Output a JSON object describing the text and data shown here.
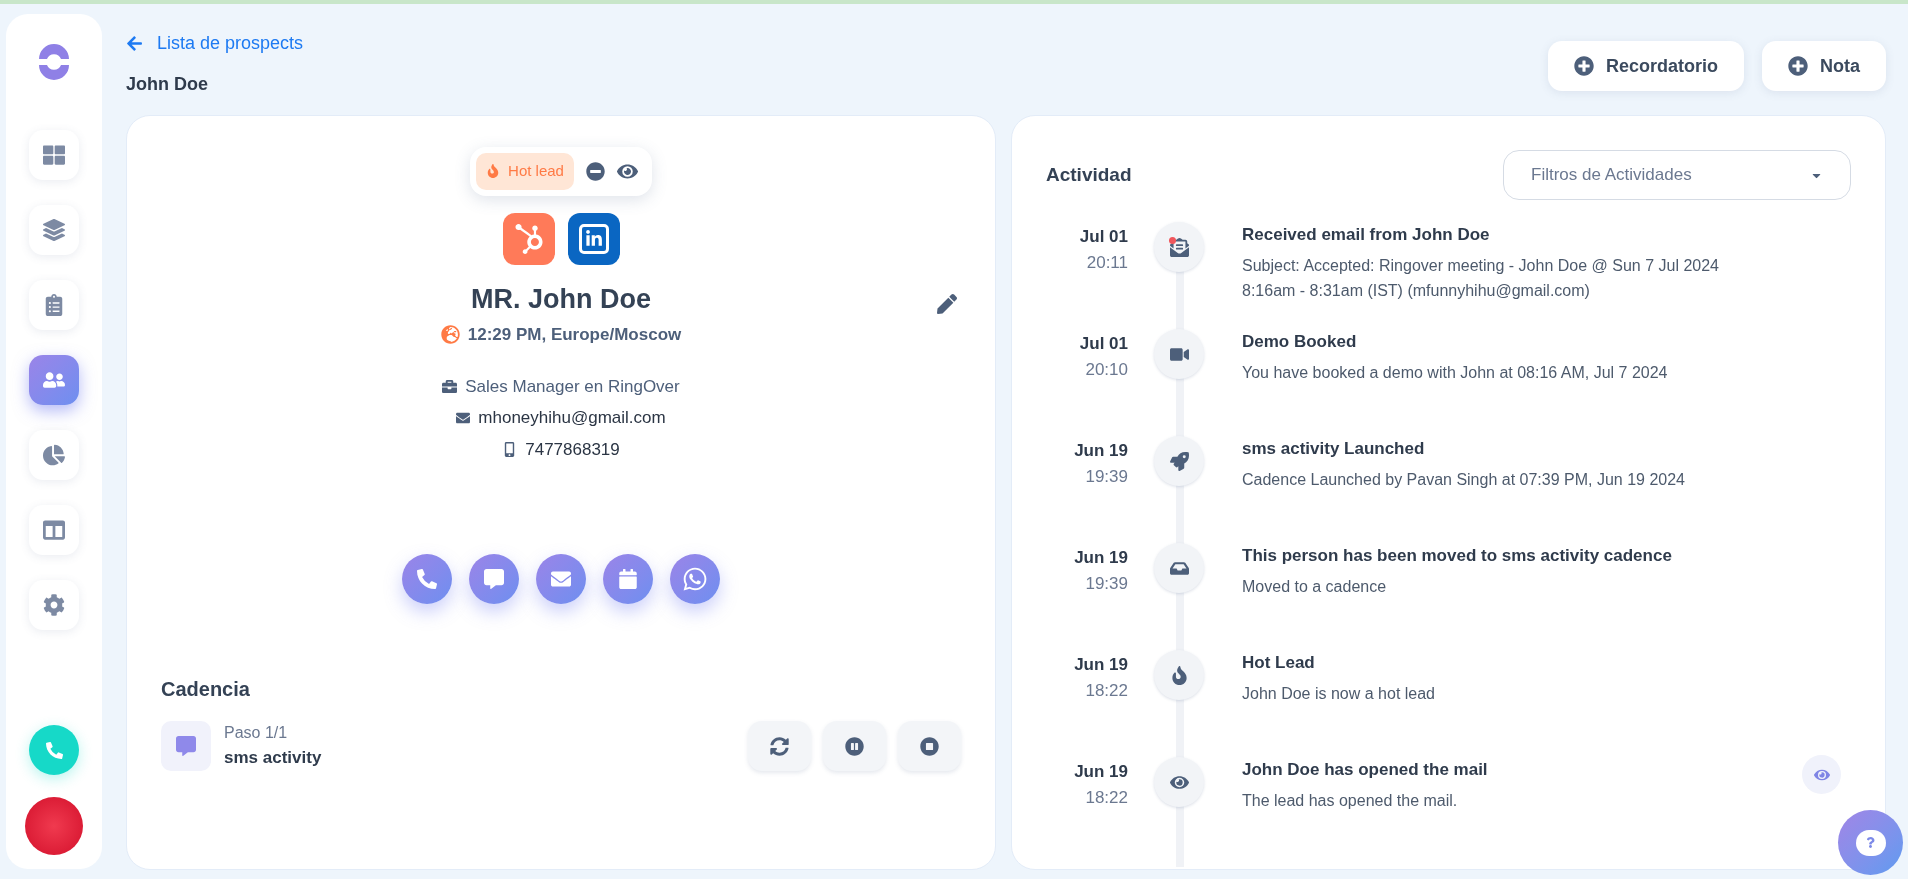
{
  "sidebar": {
    "items": [
      {
        "kind": "dashboard",
        "selected": false
      },
      {
        "kind": "stack",
        "selected": false
      },
      {
        "kind": "clipboard",
        "selected": false
      },
      {
        "kind": "people",
        "selected": true
      },
      {
        "kind": "chart",
        "selected": false
      },
      {
        "kind": "layout",
        "selected": false
      },
      {
        "kind": "settings",
        "selected": false
      }
    ]
  },
  "header": {
    "back_link": "Lista de prospects",
    "title": "John Doe",
    "buttons": [
      "Recordatorio",
      "Nota"
    ]
  },
  "contact": {
    "tag": "Hot lead",
    "name": "MR. John Doe",
    "timezone": "12:29 PM, Europe/Moscow",
    "job": "Sales Manager en RingOver",
    "email": "mhoneyhihu@gmail.com",
    "phone": "7477868319"
  },
  "cadence": {
    "title": "Cadencia",
    "step": "Paso 1/1",
    "activity": "sms activity"
  },
  "activity": {
    "title": "Actividad",
    "filter": {
      "placeholder": "Filtros de Actividades"
    },
    "items": [
      {
        "kind": "email",
        "date": "Jul 01",
        "time": "20:11",
        "title": "Received email from John Doe",
        "text": "Subject: Accepted: Ringover meeting - John Doe @ Sun 7 Jul 2024 8:16am - 8:31am (IST) (mfunnyhihu@gmail.com)",
        "viewable": false
      },
      {
        "kind": "video",
        "date": "Jul 01",
        "time": "20:10",
        "title": "Demo Booked",
        "text": "You have booked a demo with John at 08:16 AM, Jul 7 2024",
        "viewable": false
      },
      {
        "kind": "launch",
        "date": "Jun 19",
        "time": "19:39",
        "title": "sms activity Launched",
        "text": "Cadence Launched by Pavan Singh at 07:39 PM, Jun 19 2024",
        "viewable": false
      },
      {
        "kind": "move",
        "date": "Jun 19",
        "time": "19:39",
        "title": "This person has been moved to sms activity cadence",
        "text": "Moved to a cadence",
        "viewable": false
      },
      {
        "kind": "hot",
        "date": "Jun 19",
        "time": "18:22",
        "title": "Hot Lead",
        "text": "John Doe is now a hot lead",
        "viewable": false
      },
      {
        "kind": "open",
        "date": "Jun 19",
        "time": "18:22",
        "title": "John Doe has opened the mail",
        "text": "The lead has opened the mail.",
        "viewable": true
      }
    ]
  }
}
